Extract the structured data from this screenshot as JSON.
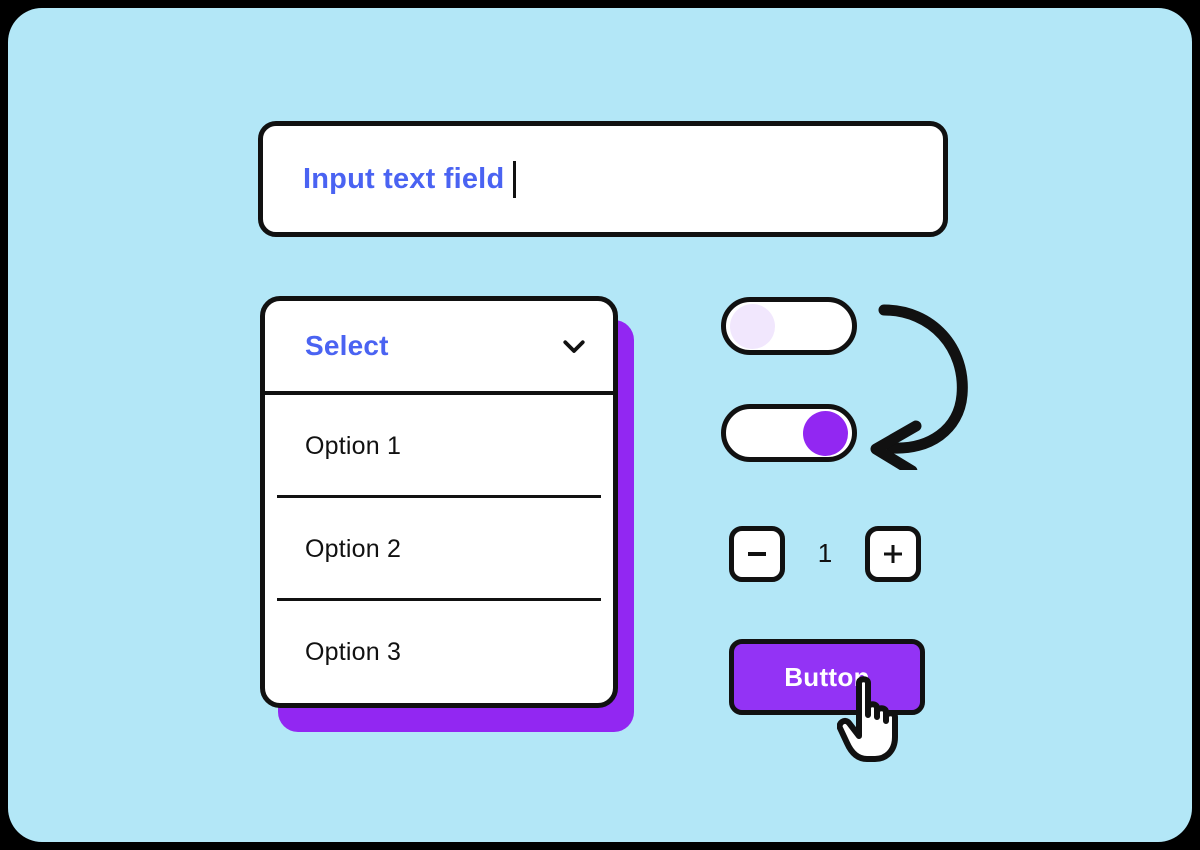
{
  "theme": {
    "background": "#b3e7f7",
    "frame_border": "#000000",
    "accent_purple": "#9333f5",
    "shadow_purple": "#9227f2",
    "accent_blue": "#4a63f2",
    "knob_off": "#f1e7fd",
    "ink": "#111111",
    "surface": "#ffffff"
  },
  "text_input": {
    "name": "input-text-field",
    "value": "Input text field",
    "placeholder": "Input text field",
    "caret_visible": true
  },
  "select": {
    "label": "Select",
    "chevron_icon": "chevron-down-icon",
    "expanded": true,
    "options": [
      {
        "label": "Option 1"
      },
      {
        "label": "Option 2"
      },
      {
        "label": "Option 3"
      }
    ]
  },
  "toggles": [
    {
      "name": "toggle-off",
      "state": "off",
      "knob_color": "#f1e7fd"
    },
    {
      "name": "toggle-on",
      "state": "on",
      "knob_color": "#9227f2"
    }
  ],
  "arrow_annotation": {
    "icon": "curved-arrow-icon",
    "direction": "clockwise-down-left"
  },
  "stepper": {
    "decrement_icon": "minus-icon",
    "increment_icon": "plus-icon",
    "value": "1"
  },
  "button": {
    "label": "Button",
    "color": "#9333f5",
    "text_color": "#ffffff"
  },
  "cursor": {
    "icon": "pointing-hand-cursor-icon"
  }
}
